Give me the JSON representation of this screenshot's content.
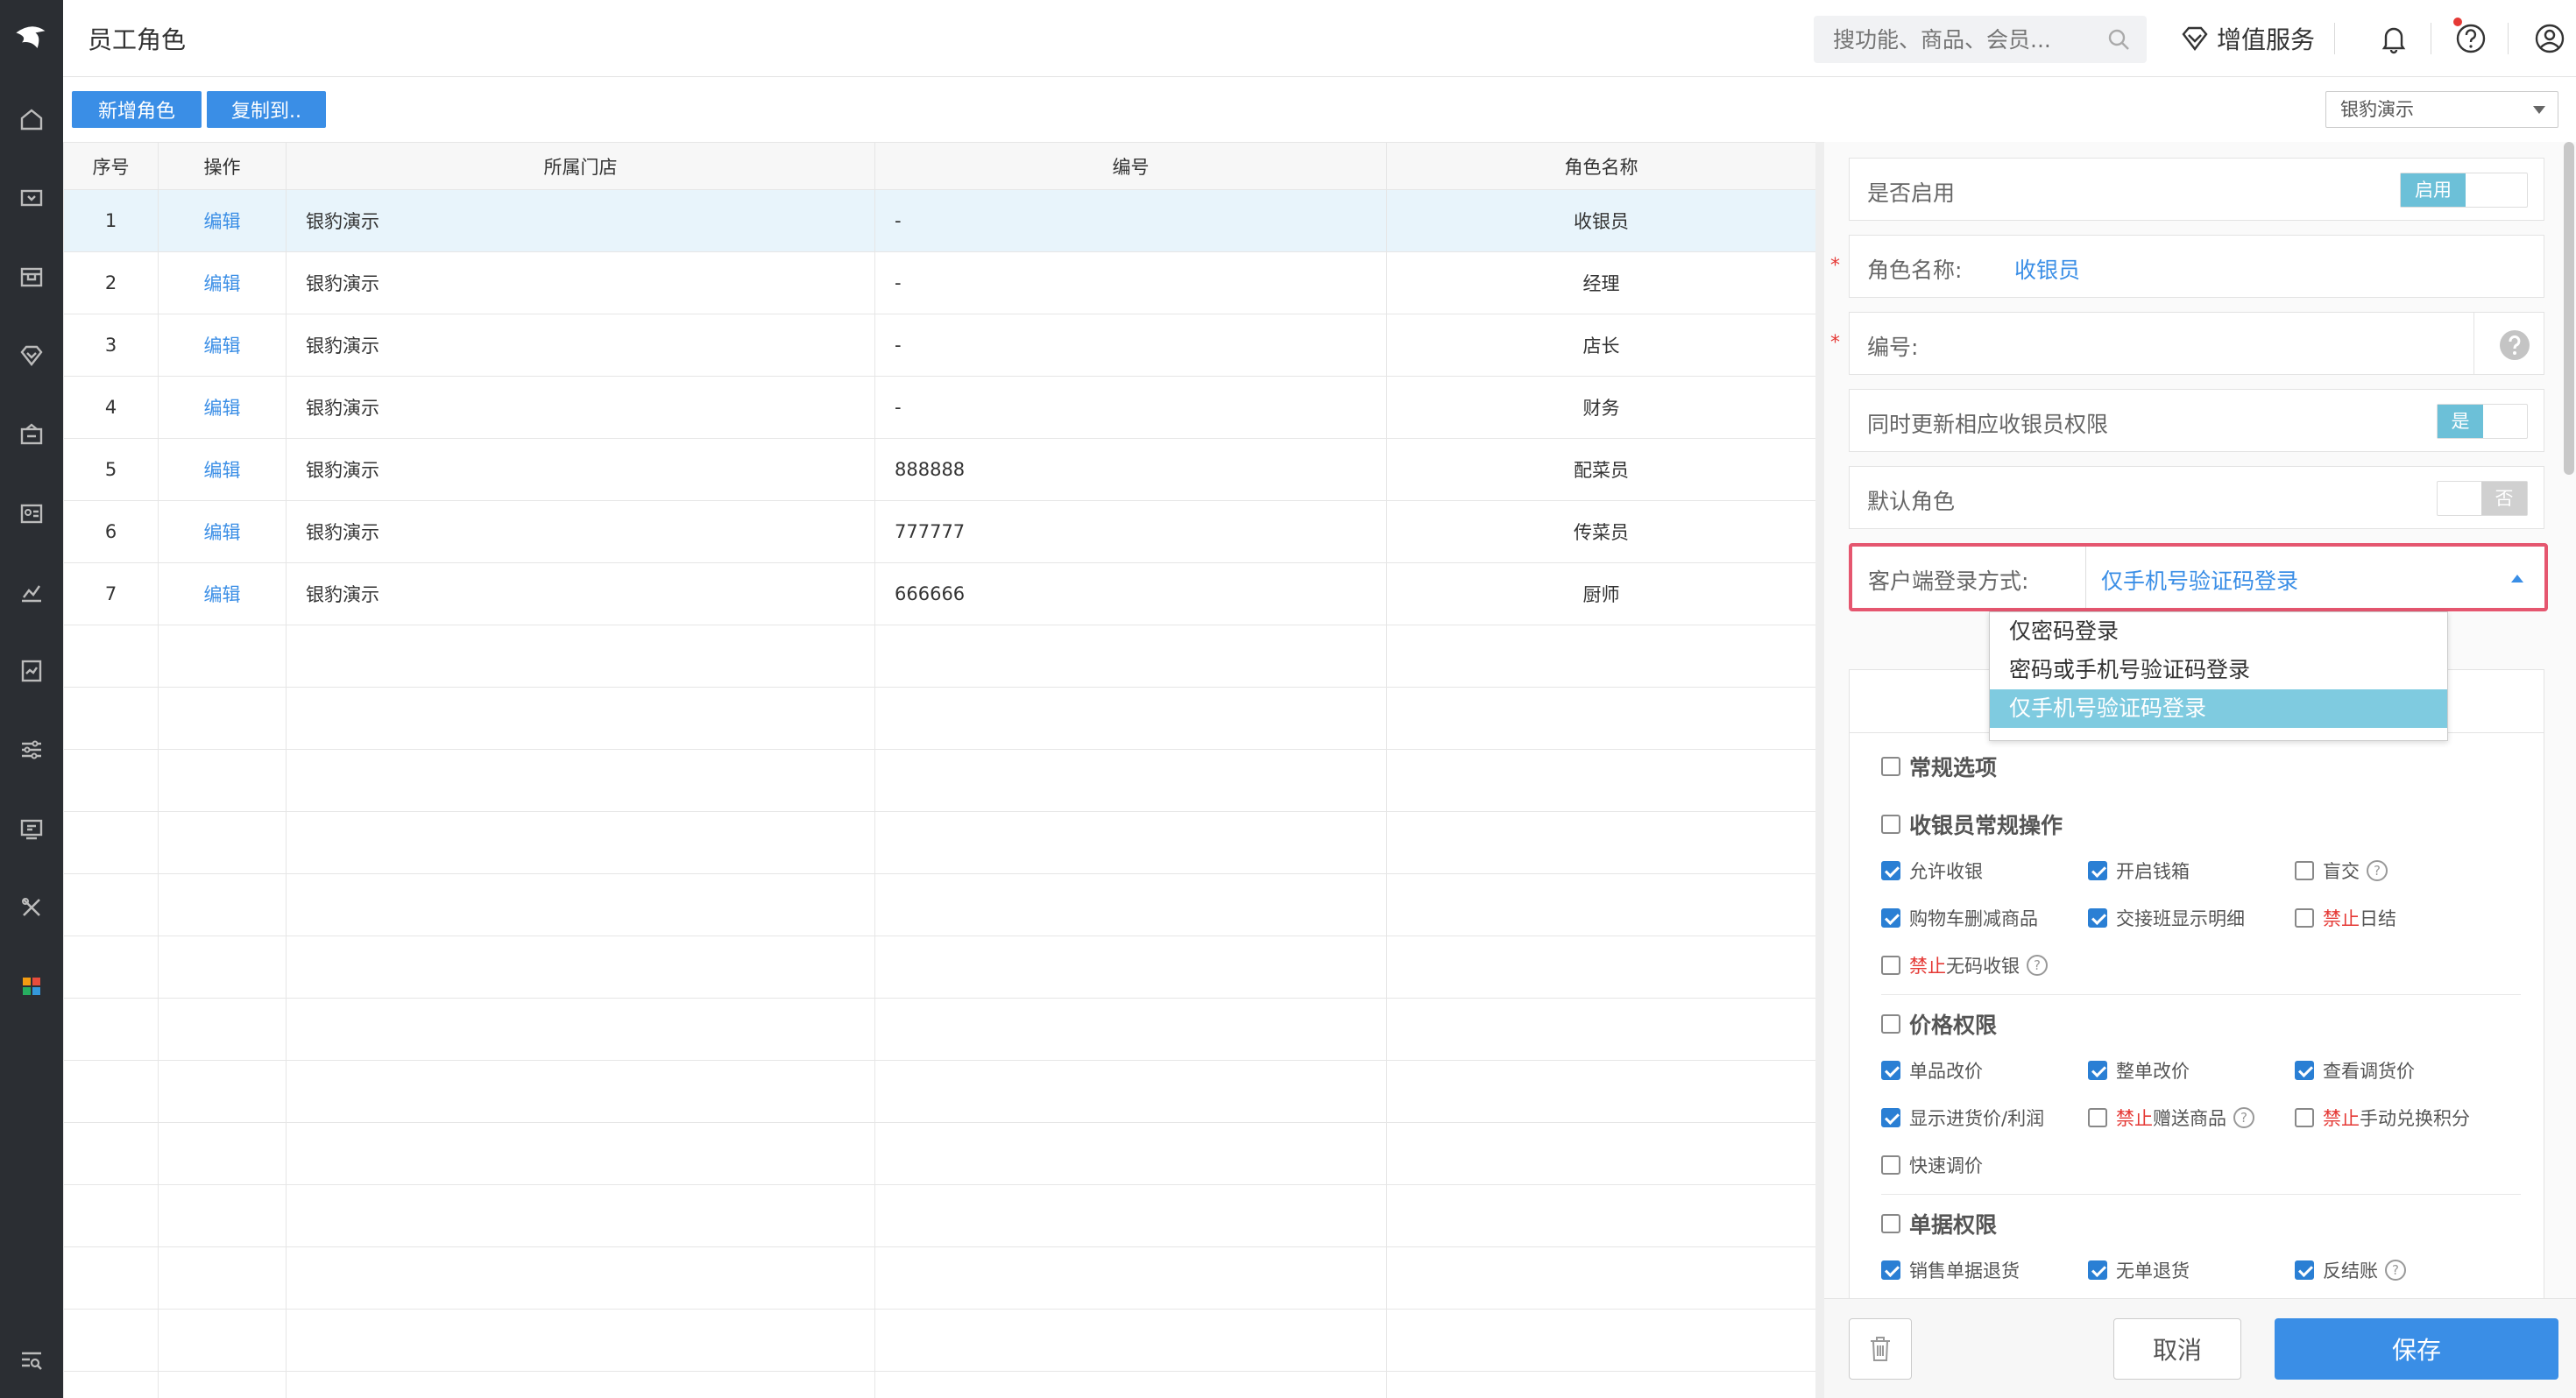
{
  "header": {
    "page_title": "员工角色",
    "search_placeholder": "搜功能、商品、会员...",
    "vip_label": "增值服务"
  },
  "toolbar": {
    "add_role": "新增角色",
    "copy_to": "复制到..",
    "store_select_value": "银豹演示"
  },
  "table": {
    "headers": [
      "序号",
      "操作",
      "所属门店",
      "编号",
      "角色名称"
    ],
    "rows": [
      {
        "no": "1",
        "action": "编辑",
        "store": "银豹演示",
        "code": "-",
        "name": "收银员"
      },
      {
        "no": "2",
        "action": "编辑",
        "store": "银豹演示",
        "code": "-",
        "name": "经理"
      },
      {
        "no": "3",
        "action": "编辑",
        "store": "银豹演示",
        "code": "-",
        "name": "店长"
      },
      {
        "no": "4",
        "action": "编辑",
        "store": "银豹演示",
        "code": "-",
        "name": "财务"
      },
      {
        "no": "5",
        "action": "编辑",
        "store": "银豹演示",
        "code": "888888",
        "name": "配菜员"
      },
      {
        "no": "6",
        "action": "编辑",
        "store": "银豹演示",
        "code": "777777",
        "name": "传菜员"
      },
      {
        "no": "7",
        "action": "编辑",
        "store": "银豹演示",
        "code": "666666",
        "name": "厨师"
      }
    ]
  },
  "form": {
    "enabled_label": "是否启用",
    "enabled_toggle": "启用",
    "role_name_label": "角色名称:",
    "role_name_value": "收银员",
    "code_label": "编号:",
    "sync_label": "同时更新相应收银员权限",
    "sync_toggle": "是",
    "default_label": "默认角色",
    "default_toggle": "否",
    "login_label": "客户端登录方式:",
    "login_value": "仅手机号验证码登录",
    "login_options": [
      "仅密码登录",
      "密码或手机号验证码登录",
      "仅手机号验证码登录"
    ]
  },
  "permissions": {
    "general": "常规选项",
    "cashier_ops": {
      "title": "收银员常规操作",
      "items": [
        "允许收银",
        "开启钱箱",
        "盲交",
        "购物车删减商品",
        "交接班显示明细",
        "日结",
        "无码收银"
      ],
      "forbid_word": "禁止"
    },
    "price": {
      "title": "价格权限",
      "items": [
        "单品改价",
        "整单改价",
        "查看调货价",
        "显示进货价/利润",
        "赠送商品",
        "手动兑换积分",
        "快速调价"
      ]
    },
    "doc": {
      "title": "单据权限",
      "items": [
        "销售单据退货",
        "无单退货",
        "反结账"
      ]
    }
  },
  "footer": {
    "cancel": "取消",
    "save": "保存"
  },
  "colors": {
    "accent": "#3a8ee6",
    "highlight_border": "#e5566f",
    "forbid": "#e53935"
  }
}
